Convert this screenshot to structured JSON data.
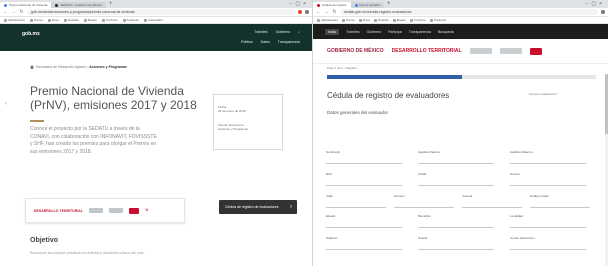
{
  "left_window": {
    "tabs": [
      {
        "label": "Premio Nacional de Vivienda",
        "active": true,
        "color": "#4285f4"
      },
      {
        "label": "SEDATU - Gobierno de México",
        "active": false,
        "color": "#13322b"
      }
    ],
    "address": "gob.mx/sedatu/acciones-y-programas/premio-nacional-de-vivienda",
    "bookmarks": [
      "Aplicaciones",
      "Correo",
      "Drive",
      "Noticias",
      "Mapas",
      "YouTube",
      "Traductor",
      "Calendario"
    ],
    "gob_header": {
      "logo": "gob.mx",
      "nav_top": [
        "Trámites",
        "Gobierno"
      ],
      "nav_bottom": [
        "Política",
        "Datos",
        "Transparencia"
      ]
    },
    "breadcrumb": {
      "path": "Secretaría de Desarrollo Agrario ›",
      "current": "Acciones y Programas"
    },
    "title": "Premio Nacional de Vivienda (PrNV), emisiones 2017 y 2018",
    "description": "Conoce el proyecto por la SEDATU a través de la CONAVI, con colaboración con INFONAVIT, FOVISSSTE y SHF, han creado los premios para otorgar el Premio en sus emisiones 2017 y 2018.",
    "share_icons": [
      "‹",
      "f",
      "t",
      "+"
    ],
    "sidebox": {
      "lines": [
        "Fecha",
        "02 de enero de 2018",
        "Tipo de documento",
        "Acciones y Programas"
      ]
    },
    "promo": {
      "label": "DESARROLLO TERRITORIAL",
      "close": "×"
    },
    "dark_button": {
      "label": "Cédula de registro de evaluadores",
      "arrow": "›"
    },
    "objetivo_title": "Objetivo",
    "objetivo_text": "Reconocer las mejores prácticas en vivienda y desarrollo urbano del país."
  },
  "right_window": {
    "tabs": [
      {
        "label": "Cédula de registro",
        "active": true,
        "color": "#c8102e"
      },
      {
        "label": "Nueva pestaña",
        "active": false,
        "color": "#4285f4"
      }
    ],
    "address": "sedatu.gob.mx/cedula-registro-evaluadores",
    "bookmarks": [
      "Aplicaciones",
      "Correo",
      "Drive",
      "Noticias",
      "Mapas",
      "YouTube",
      "Traductor"
    ],
    "gob_nav": [
      "Inicio",
      "Trámites",
      "Gobierno",
      "Participa",
      "Transparencia",
      "Búsqueda"
    ],
    "header": {
      "mx_logo": "GOBIERNO DE MÉXICO",
      "sedatu": "DESARROLLO TERRITORIAL"
    },
    "step_text": "Paso 1 de 2 - Registro",
    "step_right": "Campos obligatorios *",
    "progress_pct": 50,
    "form_title": "Cédula de registro de evaluadores",
    "section_title": "Datos generales del evaluador",
    "rows": [
      [
        "Nombre(s)",
        "Apellido Paterno",
        "Apellido Materno"
      ],
      [
        "RFC",
        "CURP",
        "Género"
      ],
      [
        "Calle",
        "Número",
        "Colonia",
        "Código postal"
      ],
      [
        "Estado",
        "Municipio",
        "Localidad"
      ],
      [
        "Teléfono",
        "Celular",
        "Correo electrónico"
      ]
    ]
  }
}
